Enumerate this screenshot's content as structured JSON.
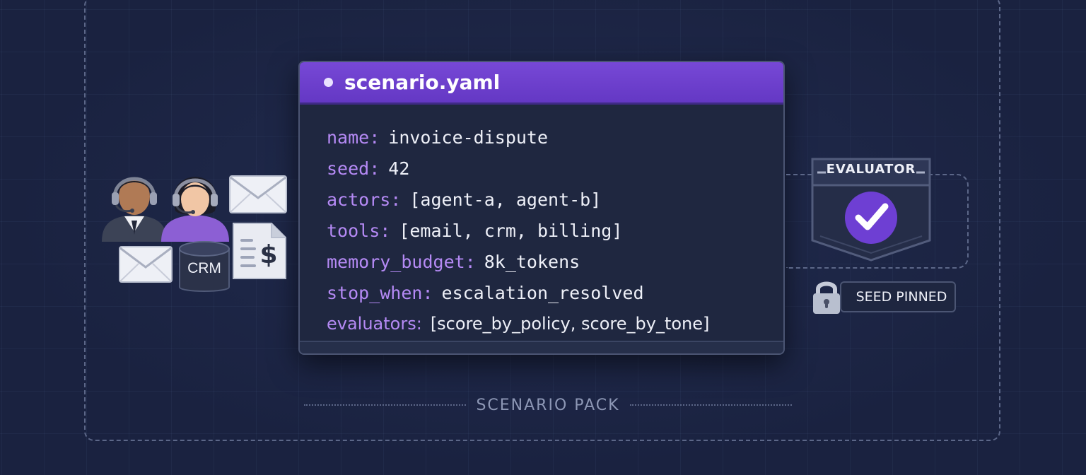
{
  "editor": {
    "filename": "scenario.yaml",
    "lines": [
      {
        "key": "name:",
        "value": "invoice-dispute"
      },
      {
        "key": "seed:",
        "value": "42"
      },
      {
        "key": "actors:",
        "value": "[agent-a, agent-b]"
      },
      {
        "key": "tools:",
        "value": "[email, crm, billing]"
      },
      {
        "key": "memory_budget:",
        "value": "8k_tokens"
      },
      {
        "key": "stop_when:",
        "value": "escalation_resolved"
      },
      {
        "key": "evaluators:",
        "value": "[score_by_policy, score_by_tone]"
      }
    ]
  },
  "icons": {
    "agents": [
      "agent-icon",
      "agent-icon"
    ],
    "crm_label": "CRM",
    "invoice_symbol": "$"
  },
  "evaluator": {
    "label": "EVALUATOR",
    "icon": "check-icon"
  },
  "seed_badge": {
    "label": "SEED PINNED",
    "icon": "lock-icon"
  },
  "pack": {
    "label": "SCENARIO PACK"
  },
  "colors": {
    "background": "#1a2240",
    "accent": "#6f42d4",
    "key_text": "#b58af5"
  }
}
